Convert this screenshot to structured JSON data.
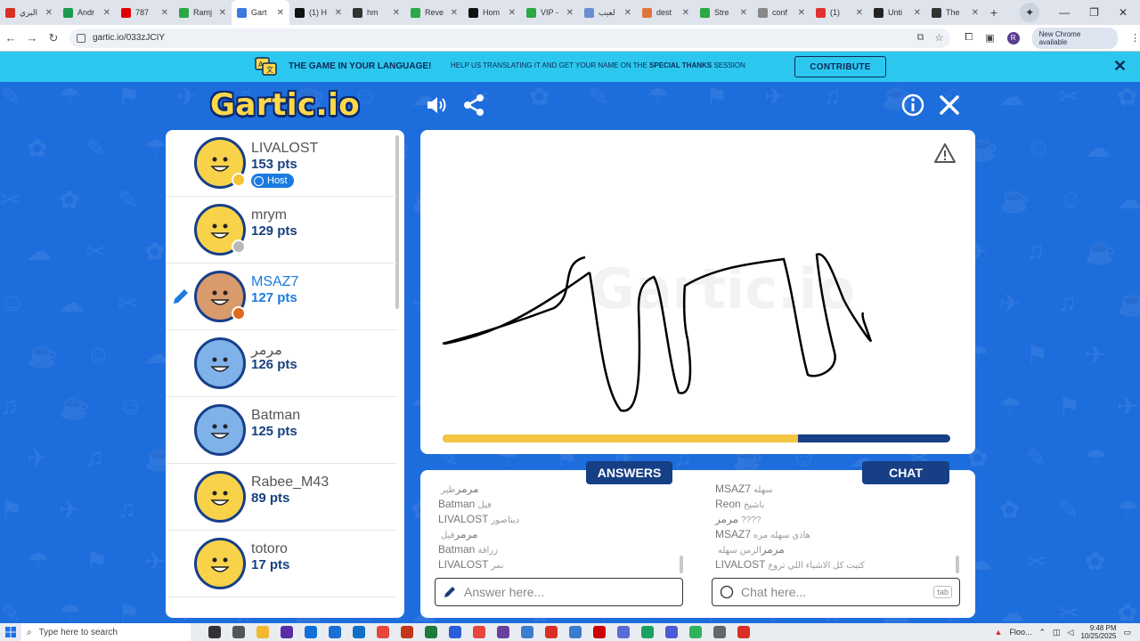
{
  "browser": {
    "tabs": [
      {
        "title": "البري",
        "color": "#d93025"
      },
      {
        "title": "Andr",
        "color": "#1a9a4b"
      },
      {
        "title": "787",
        "color": "#e00000"
      },
      {
        "title": "Ramj",
        "color": "#2aa845"
      },
      {
        "title": "Gart",
        "color": "#3b79e0",
        "active": true
      },
      {
        "title": "(1) H",
        "color": "#111111"
      },
      {
        "title": "hm",
        "color": "#333333"
      },
      {
        "title": "Reve",
        "color": "#2aa845"
      },
      {
        "title": "Hom",
        "color": "#111111"
      },
      {
        "title": "VIP -",
        "color": "#2aa845"
      },
      {
        "title": "لعيب",
        "color": "#6a8fd0"
      },
      {
        "title": "dest",
        "color": "#e0743a"
      },
      {
        "title": "Stre",
        "color": "#2aa845"
      },
      {
        "title": "conf",
        "color": "#888888"
      },
      {
        "title": "(1)",
        "color": "#e03030"
      },
      {
        "title": "Unti",
        "color": "#222222"
      },
      {
        "title": "The",
        "color": "#333333"
      }
    ],
    "url": "gartic.io/033zJCIY",
    "profile_initial": "R",
    "update_label": "New Chrome available"
  },
  "banner": {
    "headline": "THE GAME IN YOUR LANGUAGE!",
    "text_pre": "HELP US TRANSLATING IT AND GET YOUR NAME ON THE",
    "text_bold": "SPECIAL THANKS",
    "text_post": "SESSION",
    "cta": "CONTRIBUTE"
  },
  "game": {
    "logo": "Gartic.io",
    "players": [
      {
        "name": "LIVALOST",
        "pts": "153 pts",
        "host": true,
        "host_label": "Host",
        "status_color": "#f6c333"
      },
      {
        "name": "mrym",
        "pts": "129 pts",
        "status_color": "#b8b8b8"
      },
      {
        "name": "MSAZ7",
        "pts": "127 pts",
        "me": true,
        "drawing": true,
        "status_color": "#e06a1b"
      },
      {
        "name": "مرمر",
        "pts": "126 pts"
      },
      {
        "name": "Batman",
        "pts": "125 pts"
      },
      {
        "name": "Rabee_M43",
        "pts": "89 pts"
      },
      {
        "name": "totoro",
        "pts": "17 pts"
      }
    ],
    "timer_fraction": 0.7,
    "answers_label": "ANSWERS",
    "chat_label": "CHAT",
    "answers": [
      {
        "user": "مرمر",
        "text": "طير"
      },
      {
        "user": "Batman",
        "text": "فيل"
      },
      {
        "user": "LIVALOST",
        "text": "ديناصور"
      },
      {
        "user": "مرمر",
        "text": "فيل"
      },
      {
        "user": "Batman",
        "text": "زرافة"
      },
      {
        "user": "LIVALOST",
        "text": "نمر"
      }
    ],
    "chat": [
      {
        "user": "MSAZ7",
        "text": "سهله"
      },
      {
        "user": "Reon",
        "text": "باشيخ"
      },
      {
        "user": "مرمر",
        "text": "????"
      },
      {
        "user": "MSAZ7",
        "text": "هاذي سهله مره"
      },
      {
        "user": "مرمر",
        "text": "الزمن سهله"
      },
      {
        "user": "LIVALOST",
        "text": "كتبت كل الاشياء اللي تروع"
      }
    ],
    "answer_placeholder": "Answer here...",
    "chat_placeholder": "Chat here...",
    "tab_hint": "tab"
  },
  "taskbar": {
    "search_placeholder": "Type here to search",
    "weather": "Floo...",
    "time": "9:48 PM",
    "date": "10/25/2025"
  }
}
